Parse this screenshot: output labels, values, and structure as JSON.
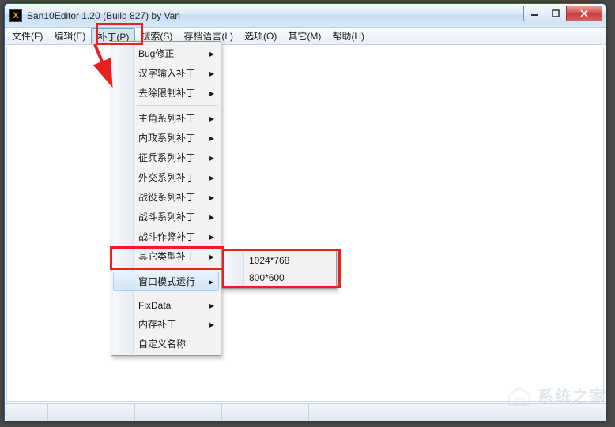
{
  "window": {
    "title": "San10Editor 1.20 (Build 827) by Van",
    "icon_letter": "X"
  },
  "menubar": [
    "文件(F)",
    "编辑(E)",
    "补丁(P)",
    "搜索(S)",
    "存档语言(L)",
    "选项(O)",
    "其它(M)",
    "帮助(H)"
  ],
  "active_menu_index": 2,
  "dropdown": {
    "groups": [
      [
        {
          "label": "Bug修正",
          "submenu": true
        },
        {
          "label": "汉字输入补丁",
          "submenu": true
        },
        {
          "label": "去除限制补丁",
          "submenu": true
        }
      ],
      [
        {
          "label": "主角系列补丁",
          "submenu": true
        },
        {
          "label": "内政系列补丁",
          "submenu": true
        },
        {
          "label": "征兵系列补丁",
          "submenu": true
        },
        {
          "label": "外交系列补丁",
          "submenu": true
        },
        {
          "label": "战役系列补丁",
          "submenu": true
        },
        {
          "label": "战斗系列补丁",
          "submenu": true
        },
        {
          "label": "战斗作弊补丁",
          "submenu": true
        },
        {
          "label": "其它类型补丁",
          "submenu": true
        }
      ],
      [
        {
          "label": "窗口模式运行",
          "submenu": true,
          "highlight": true
        }
      ],
      [
        {
          "label": "FixData",
          "submenu": true
        },
        {
          "label": "内存补丁",
          "submenu": true
        },
        {
          "label": "自定义名称",
          "submenu": false
        }
      ]
    ]
  },
  "submenu_items": [
    "1024*768",
    "800*600"
  ],
  "win_controls": {
    "min": "–",
    "max": "☐",
    "close": "✕"
  },
  "watermark": "系统之家"
}
